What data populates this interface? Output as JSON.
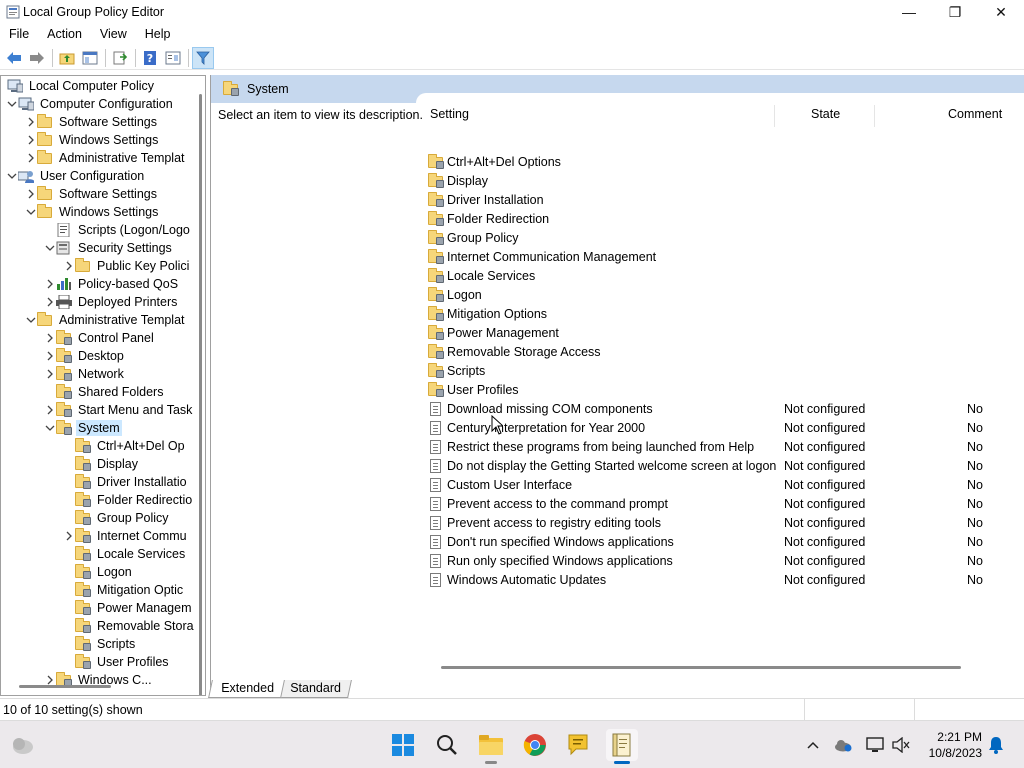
{
  "window": {
    "title": "Local Group Policy Editor",
    "minimize": "—",
    "maximize": "❐",
    "close": "✕"
  },
  "menu": [
    "File",
    "Action",
    "View",
    "Help"
  ],
  "tree": [
    {
      "label": "Local Computer Policy",
      "indent": 0,
      "chevron": "",
      "icon": "computer"
    },
    {
      "label": "Computer Configuration",
      "indent": 1,
      "chevron": "down",
      "icon": "computer"
    },
    {
      "label": "Software Settings",
      "indent": 2,
      "chevron": "right",
      "icon": "folder"
    },
    {
      "label": "Windows Settings",
      "indent": 2,
      "chevron": "right",
      "icon": "folder"
    },
    {
      "label": "Administrative Templat",
      "indent": 2,
      "chevron": "right",
      "icon": "folder"
    },
    {
      "label": "User Configuration",
      "indent": 1,
      "chevron": "down",
      "icon": "user"
    },
    {
      "label": "Software Settings",
      "indent": 2,
      "chevron": "right",
      "icon": "folder"
    },
    {
      "label": "Windows Settings",
      "indent": 2,
      "chevron": "down",
      "icon": "folder"
    },
    {
      "label": "Scripts (Logon/Logo",
      "indent": 3,
      "chevron": "",
      "icon": "script"
    },
    {
      "label": "Security Settings",
      "indent": 3,
      "chevron": "down",
      "icon": "security"
    },
    {
      "label": "Public Key Polici",
      "indent": 4,
      "chevron": "right",
      "icon": "folder"
    },
    {
      "label": "Policy-based QoS",
      "indent": 3,
      "chevron": "right",
      "icon": "chart"
    },
    {
      "label": "Deployed Printers",
      "indent": 3,
      "chevron": "right",
      "icon": "printer"
    },
    {
      "label": "Administrative Templat",
      "indent": 2,
      "chevron": "down",
      "icon": "folder"
    },
    {
      "label": "Control Panel",
      "indent": 3,
      "chevron": "right",
      "icon": "gpfolder"
    },
    {
      "label": "Desktop",
      "indent": 3,
      "chevron": "right",
      "icon": "gpfolder"
    },
    {
      "label": "Network",
      "indent": 3,
      "chevron": "right",
      "icon": "gpfolder"
    },
    {
      "label": "Shared Folders",
      "indent": 3,
      "chevron": "",
      "icon": "gpfolder"
    },
    {
      "label": "Start Menu and Task",
      "indent": 3,
      "chevron": "right",
      "icon": "gpfolder"
    },
    {
      "label": "System",
      "indent": 3,
      "chevron": "down",
      "icon": "gpfolder",
      "selected": true
    },
    {
      "label": "Ctrl+Alt+Del Op",
      "indent": 4,
      "chevron": "",
      "icon": "gpfolder"
    },
    {
      "label": "Display",
      "indent": 4,
      "chevron": "",
      "icon": "gpfolder"
    },
    {
      "label": "Driver Installatio",
      "indent": 4,
      "chevron": "",
      "icon": "gpfolder"
    },
    {
      "label": "Folder Redirectio",
      "indent": 4,
      "chevron": "",
      "icon": "gpfolder"
    },
    {
      "label": "Group Policy",
      "indent": 4,
      "chevron": "",
      "icon": "gpfolder"
    },
    {
      "label": "Internet Commu",
      "indent": 4,
      "chevron": "right",
      "icon": "gpfolder"
    },
    {
      "label": "Locale Services",
      "indent": 4,
      "chevron": "",
      "icon": "gpfolder"
    },
    {
      "label": "Logon",
      "indent": 4,
      "chevron": "",
      "icon": "gpfolder"
    },
    {
      "label": "Mitigation Optic",
      "indent": 4,
      "chevron": "",
      "icon": "gpfolder"
    },
    {
      "label": "Power Managem",
      "indent": 4,
      "chevron": "",
      "icon": "gpfolder"
    },
    {
      "label": "Removable Stora",
      "indent": 4,
      "chevron": "",
      "icon": "gpfolder"
    },
    {
      "label": "Scripts",
      "indent": 4,
      "chevron": "",
      "icon": "gpfolder"
    },
    {
      "label": "User Profiles",
      "indent": 4,
      "chevron": "",
      "icon": "gpfolder"
    },
    {
      "label": "Windows C...",
      "indent": 3,
      "chevron": "right",
      "icon": "gpfolder"
    }
  ],
  "right": {
    "header": "System",
    "description": "Select an item to view its description.",
    "columns": {
      "setting": "Setting",
      "state": "State",
      "comment": "Comment"
    },
    "rows": [
      {
        "name": "Ctrl+Alt+Del Options",
        "type": "folder",
        "state": "",
        "comment": ""
      },
      {
        "name": "Display",
        "type": "folder",
        "state": "",
        "comment": ""
      },
      {
        "name": "Driver Installation",
        "type": "folder",
        "state": "",
        "comment": ""
      },
      {
        "name": "Folder Redirection",
        "type": "folder",
        "state": "",
        "comment": ""
      },
      {
        "name": "Group Policy",
        "type": "folder",
        "state": "",
        "comment": ""
      },
      {
        "name": "Internet Communication Management",
        "type": "folder",
        "state": "",
        "comment": ""
      },
      {
        "name": "Locale Services",
        "type": "folder",
        "state": "",
        "comment": ""
      },
      {
        "name": "Logon",
        "type": "folder",
        "state": "",
        "comment": ""
      },
      {
        "name": "Mitigation Options",
        "type": "folder",
        "state": "",
        "comment": ""
      },
      {
        "name": "Power Management",
        "type": "folder",
        "state": "",
        "comment": ""
      },
      {
        "name": "Removable Storage Access",
        "type": "folder",
        "state": "",
        "comment": ""
      },
      {
        "name": "Scripts",
        "type": "folder",
        "state": "",
        "comment": ""
      },
      {
        "name": "User Profiles",
        "type": "folder",
        "state": "",
        "comment": ""
      },
      {
        "name": "Download missing COM components",
        "type": "policy",
        "state": "Not configured",
        "comment": "No"
      },
      {
        "name": "Century interpretation for Year 2000",
        "type": "policy",
        "state": "Not configured",
        "comment": "No"
      },
      {
        "name": "Restrict these programs from being launched from Help",
        "type": "policy",
        "state": "Not configured",
        "comment": "No"
      },
      {
        "name": "Do not display the Getting Started welcome screen at logon",
        "type": "policy",
        "state": "Not configured",
        "comment": "No"
      },
      {
        "name": "Custom User Interface",
        "type": "policy",
        "state": "Not configured",
        "comment": "No"
      },
      {
        "name": "Prevent access to the command prompt",
        "type": "policy",
        "state": "Not configured",
        "comment": "No"
      },
      {
        "name": "Prevent access to registry editing tools",
        "type": "policy",
        "state": "Not configured",
        "comment": "No"
      },
      {
        "name": "Don't run specified Windows applications",
        "type": "policy",
        "state": "Not configured",
        "comment": "No"
      },
      {
        "name": "Run only specified Windows applications",
        "type": "policy",
        "state": "Not configured",
        "comment": "No"
      },
      {
        "name": "Windows Automatic Updates",
        "type": "policy",
        "state": "Not configured",
        "comment": "No"
      }
    ]
  },
  "tabs": [
    "Extended",
    "Standard"
  ],
  "status": "10 of 10 setting(s) shown",
  "taskbar": {
    "time": "2:21 PM",
    "date": "10/8/2023",
    "apps": [
      "weather-icon",
      "start-icon",
      "search-icon",
      "file-explorer-icon",
      "chrome-icon",
      "notes-icon",
      "gpedit-icon"
    ]
  },
  "colors": {
    "accent": "#0067c0",
    "header": "#c6d8ee",
    "selection": "#cce8ff"
  }
}
